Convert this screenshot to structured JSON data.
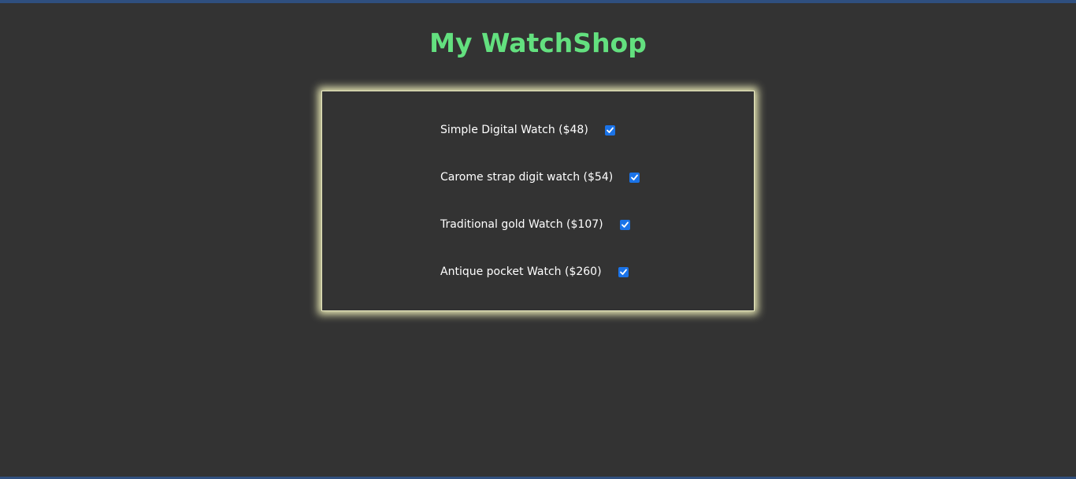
{
  "page": {
    "title": "My WatchShop"
  },
  "colors": {
    "background": "#333333",
    "title": "#63e07f",
    "panel_glow": "#eeeeb8",
    "checkbox": "#1a73e8"
  },
  "items": [
    {
      "label": "Simple Digital Watch ($48)",
      "checked": true
    },
    {
      "label": "Carome strap digit watch ($54)",
      "checked": true
    },
    {
      "label": "Traditional gold Watch ($107)",
      "checked": true
    },
    {
      "label": "Antique pocket Watch ($260)",
      "checked": true
    }
  ]
}
